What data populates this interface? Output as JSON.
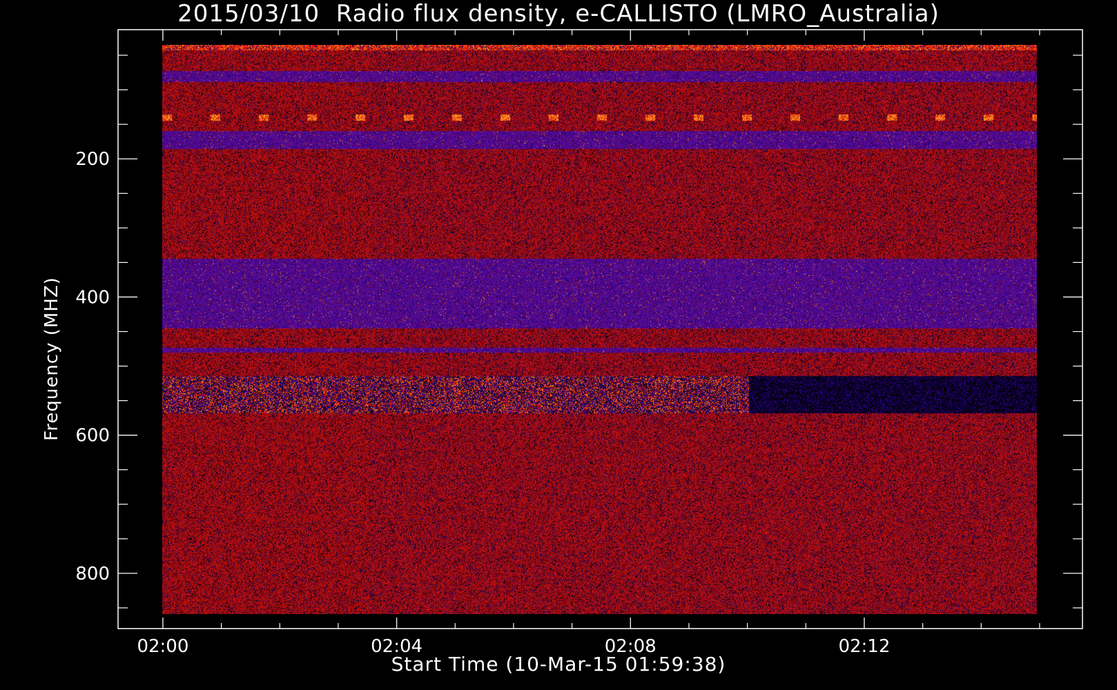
{
  "chart_data": {
    "type": "heatmap",
    "title": "2015/03/10  Radio flux density, e-CALLISTO (LMRO_Australia)",
    "xlabel": "Start Time (10-Mar-15 01:59:38)",
    "ylabel": "Frequency (MHZ)",
    "x_start_time": "01:59:38",
    "x_tick_labels": [
      "02:00",
      "02:04",
      "02:08",
      "02:12"
    ],
    "x_tick_minutes": [
      0.3667,
      4.3667,
      8.3667,
      12.3667
    ],
    "x_range_minutes": [
      -0.4,
      16.1
    ],
    "x_data_range_minutes": [
      0.3667,
      15.35
    ],
    "y_tick_labels": [
      "200",
      "400",
      "600",
      "800"
    ],
    "y_ticks_mhz": [
      200,
      400,
      600,
      800
    ],
    "y_range_mhz": [
      880,
      13
    ],
    "y_data_range_mhz": [
      45,
      870
    ],
    "y_reversed": true,
    "colormap": [
      "#000000",
      "#140060",
      "#3a0090",
      "#5a0f9a",
      "#7a0a30",
      "#a00d0d",
      "#d01010",
      "#ff2a00",
      "#ff9a20"
    ],
    "bands": [
      {
        "mhz": [
          45,
          52
        ],
        "feature": "narrow-band interference, bright"
      },
      {
        "mhz": [
          83,
          98
        ],
        "feature": "elevated emission, purple band"
      },
      {
        "mhz": [
          145,
          155
        ],
        "feature": "intermittent narrow-band interference"
      },
      {
        "mhz": [
          170,
          195
        ],
        "feature": "purple band"
      },
      {
        "mhz": [
          355,
          455
        ],
        "feature": "broad purple band"
      },
      {
        "mhz": [
          485,
          490
        ],
        "feature": "thin purple line"
      },
      {
        "mhz": [
          525,
          578
        ],
        "feature": "strong narrow-band interference, orange-yellow"
      }
    ],
    "background_level": "red noise",
    "grid": false,
    "legend": "none"
  }
}
